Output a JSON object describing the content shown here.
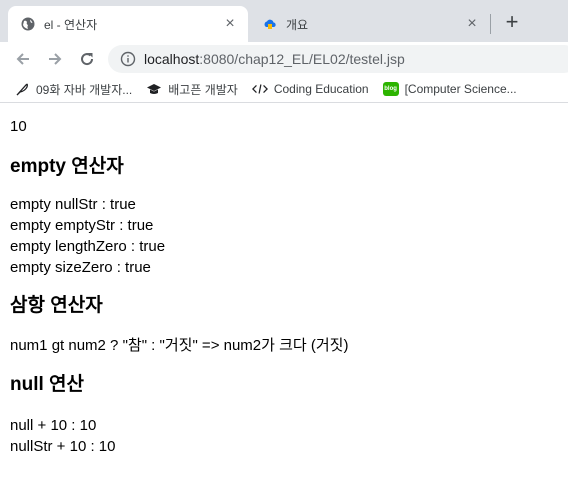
{
  "browser": {
    "tabs": [
      {
        "title": "el - 연산자",
        "close": "×"
      },
      {
        "title": "개요",
        "close": "×"
      }
    ],
    "new_tab": "+",
    "url_host": "localhost",
    "url_path": ":8080/chap12_EL/EL02/testel.jsp",
    "bookmarks": [
      {
        "label": "09화 자바 개발자...",
        "icon": "feather-icon"
      },
      {
        "label": "배고픈 개발자",
        "icon": "graduation-cap-icon"
      },
      {
        "label": "Coding Education",
        "icon": "code-icon"
      },
      {
        "label": "[Computer Science...",
        "icon": "blog-icon",
        "icon_text": "blog"
      }
    ]
  },
  "page": {
    "first_line": "10",
    "sections": [
      {
        "heading": "empty 연산자",
        "lines": [
          "empty nullStr : true",
          "empty emptyStr : true",
          "empty lengthZero : true",
          "empty sizeZero : true"
        ]
      },
      {
        "heading": "삼항 연산자",
        "lines": [
          "num1 gt num2 ? \"참\" : \"거짓\" => num2가 크다 (거짓)"
        ]
      },
      {
        "heading": "null 연산",
        "lines": [
          "null + 10 : 10",
          "nullStr + 10 : 10"
        ]
      }
    ]
  }
}
